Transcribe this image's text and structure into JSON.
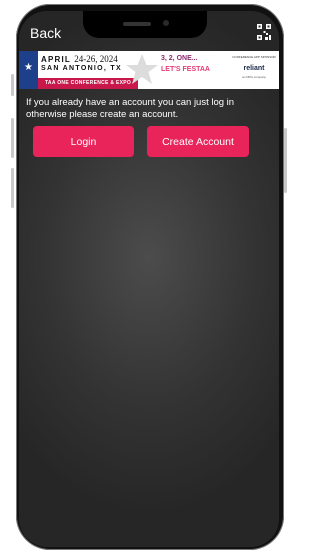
{
  "header": {
    "back_label": "Back"
  },
  "banner": {
    "dates_prefix": "APRIL",
    "dates_numbers": "24-26, 2024",
    "city": "SAN ANTONIO, TX",
    "event": "TAA ONE CONFERENCE & EXPO",
    "countdown": "3, 2, ONE...",
    "tagline": "LET'S FESTAA",
    "sponsor_heading": "CONFERENCE APP SPONSOR",
    "sponsor_name": "reliant",
    "sponsor_sub": "an NRG company"
  },
  "main": {
    "intro_text": "If you already have an account you can just log in otherwise please create an account.",
    "login_label": "Login",
    "create_account_label": "Create Account"
  },
  "colors": {
    "accent": "#e8245a",
    "background": "#333333"
  },
  "icons": {
    "header_right": "qr-code-icon"
  }
}
